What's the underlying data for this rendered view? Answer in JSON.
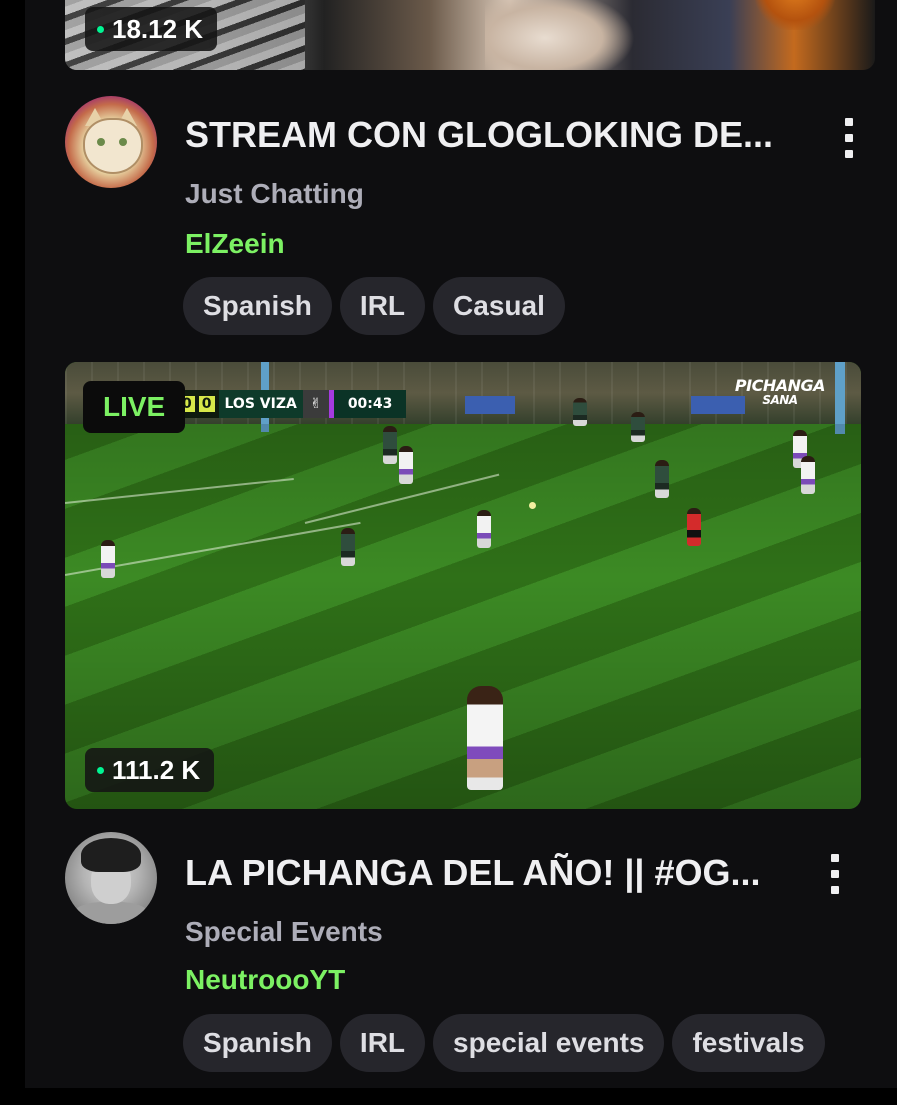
{
  "streams": [
    {
      "viewers": "18.12 K",
      "title": "STREAM CON GLOGLOKING DE...",
      "category": "Just Chatting",
      "channel": "ElZeein",
      "tags": [
        "Spanish",
        "IRL",
        "Casual"
      ]
    },
    {
      "live_label": "LIVE",
      "viewers": "111.2 K",
      "title": "LA PICHANGA DEL AÑO! || #OG...",
      "category": "Special Events",
      "channel": "NeutroooYT",
      "tags": [
        "Spanish",
        "IRL",
        "special events",
        "festivals"
      ],
      "scoreboard": {
        "home_score": "0",
        "away_score": "0",
        "team": "LOS VIZA",
        "clock": "00:43",
        "brand_line1": "PICHANGA",
        "brand_line2": "SANA"
      }
    }
  ],
  "colors": {
    "background": "#0e0e10",
    "channel_green": "#7cf163",
    "live_dot": "#00f593",
    "tag_bg": "#26262c"
  },
  "icons": [
    "more-options-icon",
    "live-dot-icon"
  ]
}
